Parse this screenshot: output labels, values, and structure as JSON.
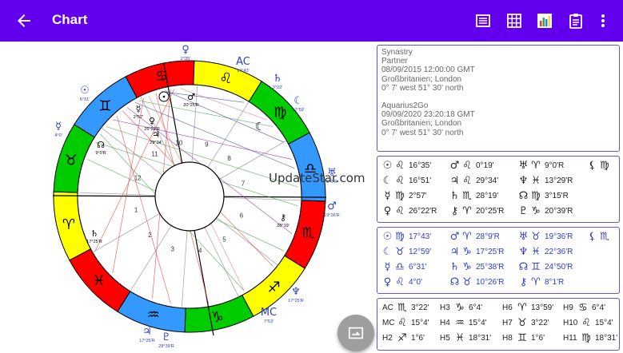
{
  "appbar": {
    "title": "Chart",
    "color": "#6200ee",
    "actions": [
      "list-icon",
      "grid-icon",
      "bar-chart-icon",
      "clipboard-icon",
      "more-vert-icon"
    ]
  },
  "watermark": "UpdateStar.com",
  "chart": {
    "house_numbers": [
      "1",
      "2",
      "3",
      "4",
      "5",
      "6",
      "7",
      "8",
      "9",
      "10",
      "11",
      "12"
    ],
    "sign_colors": [
      "#ff0000",
      "#ffff00",
      "#00cc00",
      "#3399ff"
    ],
    "outer_labels": [
      "2°35'",
      "17°43'",
      "3°22'",
      "12°59'",
      "6°31'",
      "4°0'",
      "9°0'R",
      "19°36'R",
      "17°25'R",
      "7°53'",
      "17°25'R",
      "28°39'R",
      "10°26'R",
      "8°1'R",
      "17°25'R",
      "21°16'R"
    ],
    "inner_labels": [
      "2°57'",
      "26°22'R",
      "29°34'",
      "20°25'R",
      "28°19'",
      "9°0'R",
      "17°25'R"
    ]
  },
  "info": {
    "lines_1": [
      "Synastry",
      "Partner",
      "08/09/2015 12:00:00 GMT",
      "Großbritanien; London",
      "0° 7' west    51° 30' north"
    ],
    "lines_2": [
      "Aquarius2Go",
      "09/09/2020 23:20:18 GMT",
      "Großbritanien; London",
      "0° 7' west    51° 30' north"
    ]
  },
  "partner_positions": [
    {
      "planet": "☉",
      "sign": "♌",
      "deg": "16°35'"
    },
    {
      "planet": "☾",
      "sign": "♌",
      "deg": "16°51'"
    },
    {
      "planet": "☿",
      "sign": "♍",
      "deg": "2°57'"
    },
    {
      "planet": "♀",
      "sign": "♌",
      "deg": "26°22'R"
    },
    {
      "planet": "♂",
      "sign": "♌",
      "deg": "0°19'"
    },
    {
      "planet": "♃",
      "sign": "♌",
      "deg": "29°34'"
    },
    {
      "planet": "♄",
      "sign": "♏",
      "deg": "28°19'"
    },
    {
      "planet": "⚷",
      "sign": "♈",
      "deg": "20°25'R"
    },
    {
      "planet": "♅",
      "sign": "♈",
      "deg": "9°0'R"
    },
    {
      "planet": "♆",
      "sign": "♓",
      "deg": "13°29'R"
    },
    {
      "planet": "☊",
      "sign": "♍",
      "deg": "3°15'R"
    },
    {
      "planet": "♇",
      "sign": "♑",
      "deg": "20°39'R"
    }
  ],
  "partner_extra": {
    "planet": "⚸",
    "sign": "♍"
  },
  "aquarius_positions": [
    {
      "planet": "☉",
      "sign": "♍",
      "deg": "17°43'"
    },
    {
      "planet": "☾",
      "sign": "♉",
      "deg": "12°59'"
    },
    {
      "planet": "☿",
      "sign": "♎",
      "deg": "6°31'"
    },
    {
      "planet": "♀",
      "sign": "♌",
      "deg": "4°0'"
    },
    {
      "planet": "♂",
      "sign": "♈",
      "deg": "28°9'R"
    },
    {
      "planet": "♃",
      "sign": "♑",
      "deg": "17°25'R"
    },
    {
      "planet": "♄",
      "sign": "♑",
      "deg": "25°38'R"
    },
    {
      "planet": "☊",
      "sign": "♉",
      "deg": "10°26'R"
    },
    {
      "planet": "♅",
      "sign": "♉",
      "deg": "19°36'R"
    },
    {
      "planet": "♆",
      "sign": "♓",
      "deg": "22°36'R"
    },
    {
      "planet": "☊",
      "sign": "♊",
      "deg": "24°50'R"
    },
    {
      "planet": "⚷",
      "sign": "♈",
      "deg": "8°1'R"
    }
  ],
  "aquarius_extra": {
    "planet": "⚸",
    "sign": "♏"
  },
  "houses": [
    {
      "label": "AC",
      "sign": "♏",
      "deg": "3°22'"
    },
    {
      "label": "MC",
      "sign": "♌",
      "deg": "15°4'"
    },
    {
      "label": "H2",
      "sign": "♐",
      "deg": "1°6'"
    },
    {
      "label": "H3",
      "sign": "♑",
      "deg": "6°4'"
    },
    {
      "label": "H4",
      "sign": "♒",
      "deg": "15°4'"
    },
    {
      "label": "H5",
      "sign": "♓",
      "deg": "18°31'"
    },
    {
      "label": "H6",
      "sign": "♈",
      "deg": "13°59'"
    },
    {
      "label": "H7",
      "sign": "♉",
      "deg": "3°22'"
    },
    {
      "label": "H8",
      "sign": "♊",
      "deg": "1°6'"
    },
    {
      "label": "H9",
      "sign": "♋",
      "deg": "6°4'"
    },
    {
      "label": "H10",
      "sign": "♌",
      "deg": "15°4'"
    },
    {
      "label": "H11",
      "sign": "♍",
      "deg": "18°31'"
    }
  ]
}
